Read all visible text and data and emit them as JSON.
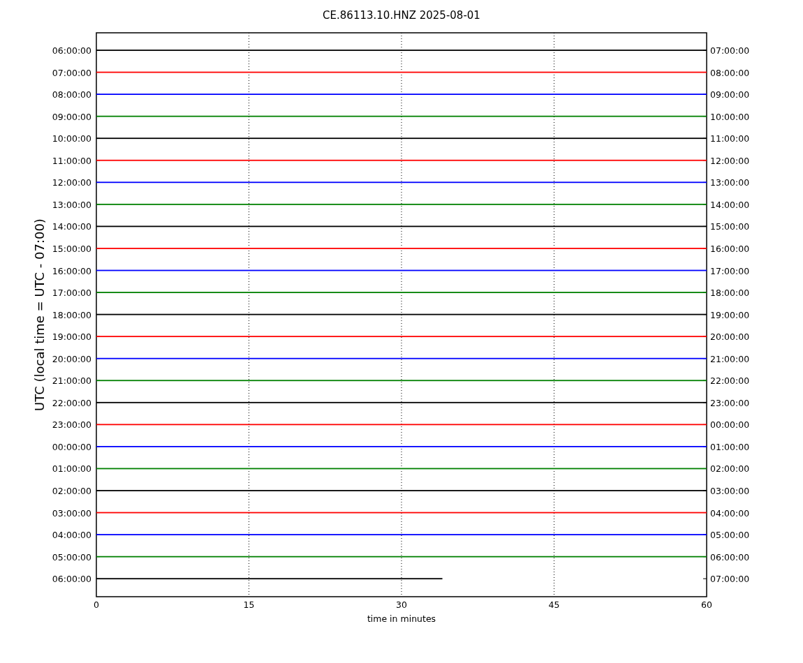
{
  "title": "CE.86113.10.HNZ 2025-08-01",
  "ylabel": "UTC (local time = UTC - 07:00)",
  "xlabel": "time in minutes",
  "xticks": [
    "0",
    "15",
    "30",
    "45",
    "60"
  ],
  "rows": [
    {
      "left": "06:00:00",
      "right": "07:00:00",
      "color": "#000000",
      "level": 1
    },
    {
      "left": "07:00:00",
      "right": "08:00:00",
      "color": "#ff0000",
      "level": 1
    },
    {
      "left": "08:00:00",
      "right": "09:00:00",
      "color": "#0000ff",
      "level": 1
    },
    {
      "left": "09:00:00",
      "right": "10:00:00",
      "color": "#008000",
      "level": 1
    },
    {
      "left": "10:00:00",
      "right": "11:00:00",
      "color": "#000000",
      "level": 1
    },
    {
      "left": "11:00:00",
      "right": "12:00:00",
      "color": "#ff0000",
      "level": 1
    },
    {
      "left": "12:00:00",
      "right": "13:00:00",
      "color": "#0000ff",
      "level": 1
    },
    {
      "left": "13:00:00",
      "right": "14:00:00",
      "color": "#008000",
      "level": 1
    },
    {
      "left": "14:00:00",
      "right": "15:00:00",
      "color": "#000000",
      "level": 1
    },
    {
      "left": "15:00:00",
      "right": "16:00:00",
      "color": "#ff0000",
      "level": 1
    },
    {
      "left": "16:00:00",
      "right": "17:00:00",
      "color": "#0000ff",
      "level": 1
    },
    {
      "left": "17:00:00",
      "right": "18:00:00",
      "color": "#008000",
      "level": 1
    },
    {
      "left": "18:00:00",
      "right": "19:00:00",
      "color": "#000000",
      "level": 1
    },
    {
      "left": "19:00:00",
      "right": "20:00:00",
      "color": "#ff0000",
      "level": 1
    },
    {
      "left": "20:00:00",
      "right": "21:00:00",
      "color": "#0000ff",
      "level": 1
    },
    {
      "left": "21:00:00",
      "right": "22:00:00",
      "color": "#008000",
      "level": 1
    },
    {
      "left": "22:00:00",
      "right": "23:00:00",
      "color": "#000000",
      "level": 1
    },
    {
      "left": "23:00:00",
      "right": "00:00:00",
      "color": "#ff0000",
      "level": 1
    },
    {
      "left": "00:00:00",
      "right": "01:00:00",
      "color": "#0000ff",
      "level": 1
    },
    {
      "left": "01:00:00",
      "right": "02:00:00",
      "color": "#008000",
      "level": 1
    },
    {
      "left": "02:00:00",
      "right": "03:00:00",
      "color": "#000000",
      "level": 1
    },
    {
      "left": "03:00:00",
      "right": "04:00:00",
      "color": "#ff0000",
      "level": 1
    },
    {
      "left": "04:00:00",
      "right": "05:00:00",
      "color": "#0000ff",
      "level": 1
    },
    {
      "left": "05:00:00",
      "right": "06:00:00",
      "color": "#008000",
      "level": 1
    },
    {
      "left": "06:00:00",
      "right": "07:00:00",
      "color": "#000000",
      "level": 0.567
    }
  ]
}
